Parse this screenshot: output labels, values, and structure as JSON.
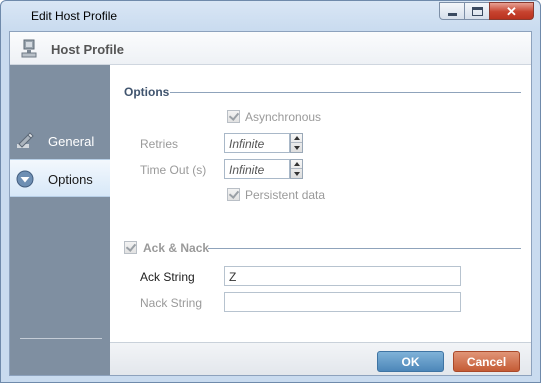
{
  "window": {
    "title": "Edit Host Profile",
    "controls": {
      "minimize": "minimize-icon",
      "maximize": "maximize-icon",
      "close": "close-icon"
    }
  },
  "header": {
    "title": "Host Profile",
    "icon": "host-computer-icon"
  },
  "sidebar": {
    "items": [
      {
        "label": "General",
        "icon": "pencil-icon",
        "selected": false
      },
      {
        "label": "Options",
        "icon": "chevron-down-circle-icon",
        "selected": true
      }
    ]
  },
  "options_group": {
    "title": "Options",
    "asynchronous": {
      "label": "Asynchronous",
      "checked": true,
      "enabled": false
    },
    "retries": {
      "label": "Retries",
      "value": "Infinite"
    },
    "timeout": {
      "label": "Time Out (s)",
      "value": "Infinite"
    },
    "persistent": {
      "label": "Persistent data",
      "checked": true,
      "enabled": false
    }
  },
  "ack_group": {
    "title": "Ack & Nack",
    "checked": true,
    "ack_string": {
      "label": "Ack String",
      "value": "Z"
    },
    "nack_string": {
      "label": "Nack String",
      "value": ""
    }
  },
  "footer": {
    "ok_label": "OK",
    "cancel_label": "Cancel"
  },
  "colors": {
    "ok": "#5b95c5",
    "cancel": "#d0683f",
    "sidebar": "#7f8fa1",
    "selected_nav": "#e3eef9"
  }
}
